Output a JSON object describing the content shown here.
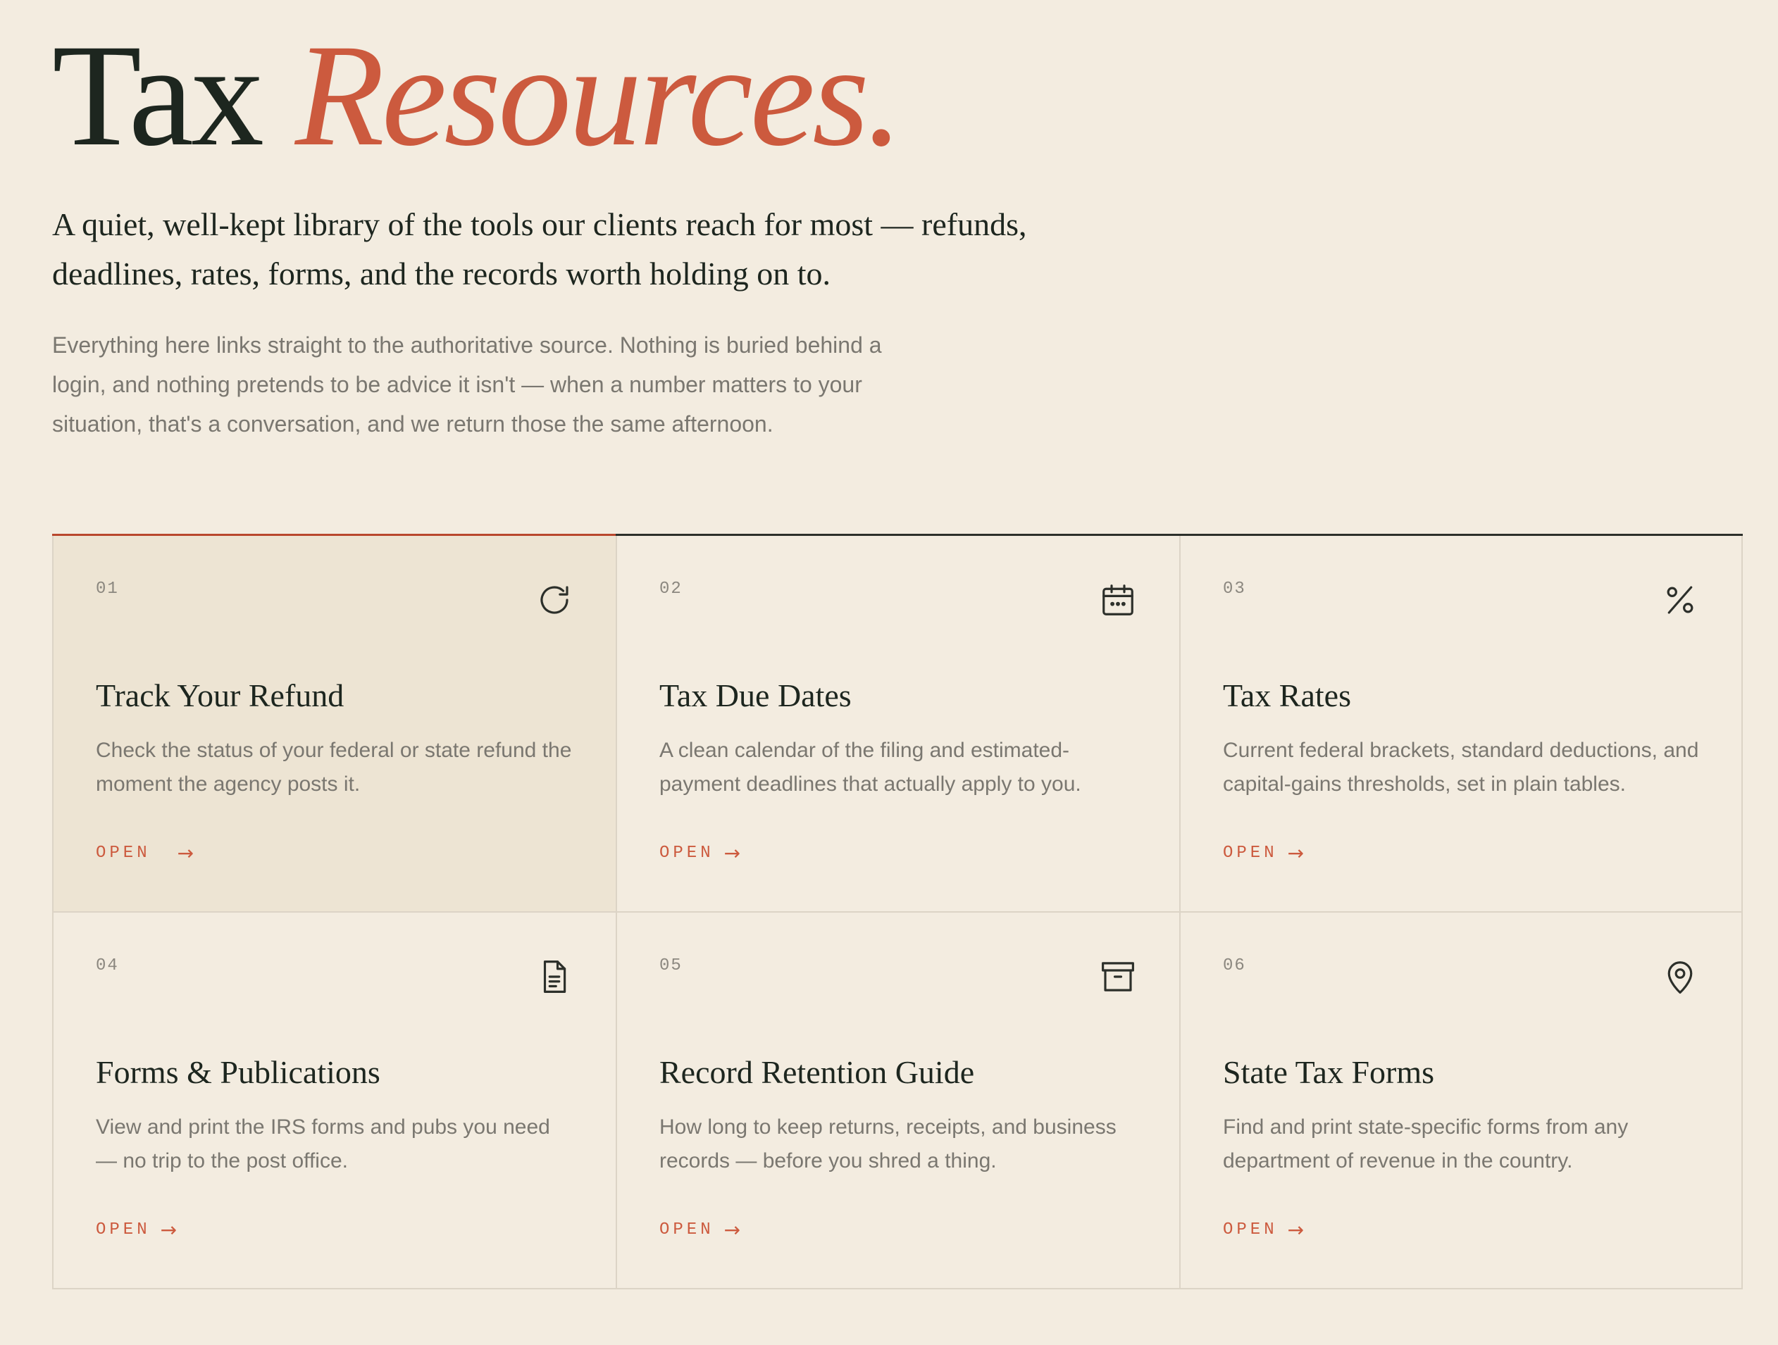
{
  "header": {
    "title_plain": "Tax",
    "title_accent": "Resources.",
    "lead": "A quiet, well-kept library of the tools our clients reach for most — refunds, deadlines, rates, forms, and the records worth holding on to.",
    "body": "Everything here links straight to the authoritative source. Nothing is buried behind a login, and nothing pretends to be advice it isn't — when a number matters to your situation, that's a conversation, and we return those the same afternoon."
  },
  "colors": {
    "background": "#f3ece0",
    "accent": "#cc5a3e",
    "active_card": "#ede4d3",
    "ink": "#1d261f"
  },
  "cards": [
    {
      "num": "01",
      "title": "Track Your Refund",
      "desc": "Check the status of your federal or state refund the moment the agency posts it.",
      "link": "OPEN",
      "arrow": "→",
      "icon": "refresh-icon"
    },
    {
      "num": "02",
      "title": "Tax Due Dates",
      "desc": "A clean calendar of the filing and estimated-payment deadlines that actually apply to you.",
      "link": "OPEN",
      "arrow": "→",
      "icon": "calendar-icon"
    },
    {
      "num": "03",
      "title": "Tax Rates",
      "desc": "Current federal brackets, standard deductions, and capital-gains thresholds, set in plain tables.",
      "link": "OPEN",
      "arrow": "→",
      "icon": "percent-icon"
    },
    {
      "num": "04",
      "title": "Forms & Publications",
      "desc": "View and print the IRS forms and pubs you need — no trip to the post office.",
      "link": "OPEN",
      "arrow": "→",
      "icon": "document-icon"
    },
    {
      "num": "05",
      "title": "Record Retention Guide",
      "desc": "How long to keep returns, receipts, and business records — before you shred a thing.",
      "link": "OPEN",
      "arrow": "→",
      "icon": "archive-icon"
    },
    {
      "num": "06",
      "title": "State Tax Forms",
      "desc": "Find and print state-specific forms from any department of revenue in the country.",
      "link": "OPEN",
      "arrow": "→",
      "icon": "map-pin-icon"
    }
  ]
}
